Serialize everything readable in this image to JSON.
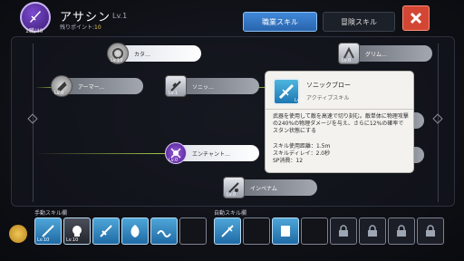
{
  "header": {
    "job_level": "1職/40",
    "class_name": "アサシン",
    "class_level": "Lv.1",
    "points_label": "残りポイント:",
    "points_value": "10",
    "tabs": [
      {
        "label": "職業スキル",
        "active": true
      },
      {
        "label": "冒険スキル",
        "active": false
      }
    ]
  },
  "skill_tree": {
    "nodes": [
      {
        "label": "カタ…",
        "level": "Lv.10",
        "active": true
      },
      {
        "label": "グリム…",
        "level": "Lv.0",
        "active": false
      },
      {
        "label": "アーマー…",
        "level": "Lv.0",
        "active": false
      },
      {
        "label": "ソニッ…",
        "level": "Lv.1",
        "active": false
      },
      {
        "label": "エンチャント…",
        "level": "Lv.0",
        "active": true
      },
      {
        "label": "インベナム",
        "level": "Lv.0",
        "active": false
      }
    ]
  },
  "tooltip": {
    "name": "ソニックブロー",
    "type": "アクティブスキル",
    "level": "Lv.1",
    "description": "武器を使用して敵を高速で切り刻む。敵単体に物理攻撃の240%の物理ダメージを与え、さらに12%の確率でスタン状態にする",
    "stats": [
      "スキル使用距離：1.5m",
      "スキルディレイ：2.0秒",
      "SP消費：12"
    ]
  },
  "manual_bar": {
    "label": "手動スキル欄",
    "slots": [
      {
        "level": "Lv.10"
      },
      {
        "level": "Lv.10"
      },
      {
        "level": ""
      },
      {
        "level": ""
      },
      {
        "level": ""
      },
      {
        "level": ""
      }
    ]
  },
  "auto_bar": {
    "label": "自動スキル欄",
    "slots": [
      {
        "state": "filled"
      },
      {
        "state": "empty"
      },
      {
        "state": "filled"
      },
      {
        "state": "empty"
      },
      {
        "state": "locked"
      },
      {
        "state": "locked"
      },
      {
        "state": "locked"
      },
      {
        "state": "locked"
      }
    ]
  },
  "colors": {
    "accent_blue": "#3f88d8",
    "close_red": "#d24633",
    "tooltip_bg": "#f3f2ee",
    "points_gold": "#e4c85c",
    "link_green": "#a7d34a"
  }
}
